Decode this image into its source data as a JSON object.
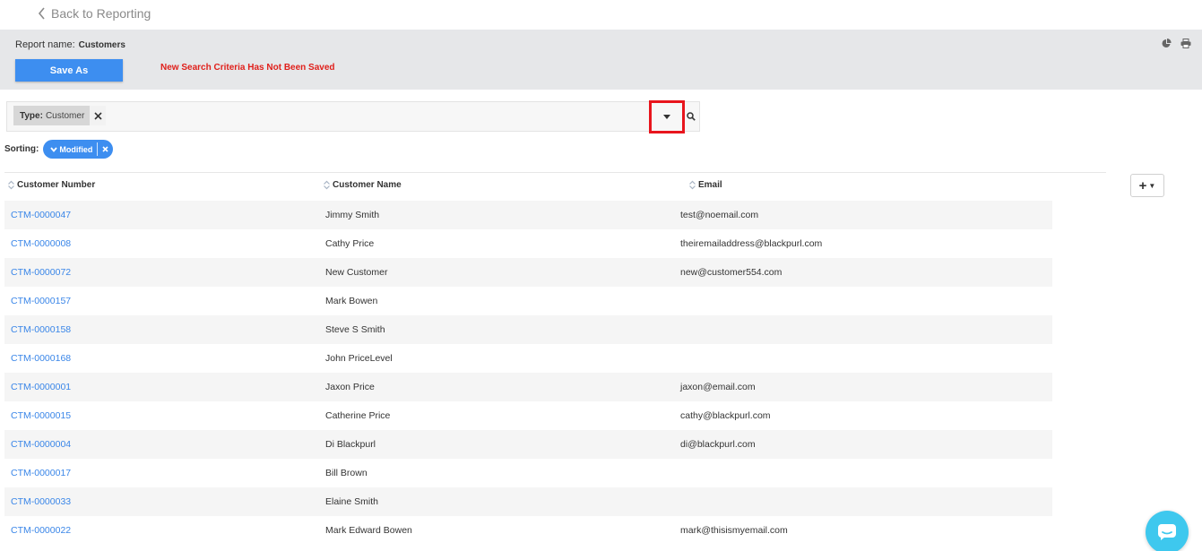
{
  "nav": {
    "back_label": "Back to Reporting"
  },
  "report": {
    "name_label": "Report name:",
    "name_value": "Customers",
    "save_as_label": "Save As",
    "unsaved_warning": "New Search Criteria Has Not Been Saved"
  },
  "filter": {
    "chip_key": "Type:",
    "chip_value": "Customer"
  },
  "sorting": {
    "label": "Sorting:",
    "field": "Modified"
  },
  "table": {
    "headers": [
      "Customer Number",
      "Customer Name",
      "Email"
    ],
    "rows": [
      {
        "number": "CTM-0000047",
        "name": "Jimmy Smith",
        "email": "test@noemail.com"
      },
      {
        "number": "CTM-0000008",
        "name": "Cathy Price",
        "email": "theiremailaddress@blackpurl.com"
      },
      {
        "number": "CTM-0000072",
        "name": "New Customer",
        "email": "new@customer554.com"
      },
      {
        "number": "CTM-0000157",
        "name": "Mark Bowen",
        "email": ""
      },
      {
        "number": "CTM-0000158",
        "name": "Steve S Smith",
        "email": ""
      },
      {
        "number": "CTM-0000168",
        "name": "John PriceLevel",
        "email": ""
      },
      {
        "number": "CTM-0000001",
        "name": "Jaxon Price",
        "email": "jaxon@email.com"
      },
      {
        "number": "CTM-0000015",
        "name": "Catherine Price",
        "email": "cathy@blackpurl.com"
      },
      {
        "number": "CTM-0000004",
        "name": "Di Blackpurl",
        "email": "di@blackpurl.com"
      },
      {
        "number": "CTM-0000017",
        "name": "Bill Brown",
        "email": ""
      },
      {
        "number": "CTM-0000033",
        "name": "Elaine Smith",
        "email": ""
      },
      {
        "number": "CTM-0000022",
        "name": "Mark Edward Bowen",
        "email": "mark@thisismyemail.com"
      }
    ]
  },
  "colors": {
    "accent": "#3d8ef0",
    "link": "#3a86e8",
    "warning": "#e0201b",
    "highlight_box": "#e8151d",
    "chat": "#3ec8ee"
  },
  "icons": [
    "chevron-left-icon",
    "pie-chart-icon",
    "print-icon",
    "close-icon",
    "caret-down-icon",
    "search-icon",
    "sort-icon",
    "plus-icon",
    "chat-icon"
  ]
}
